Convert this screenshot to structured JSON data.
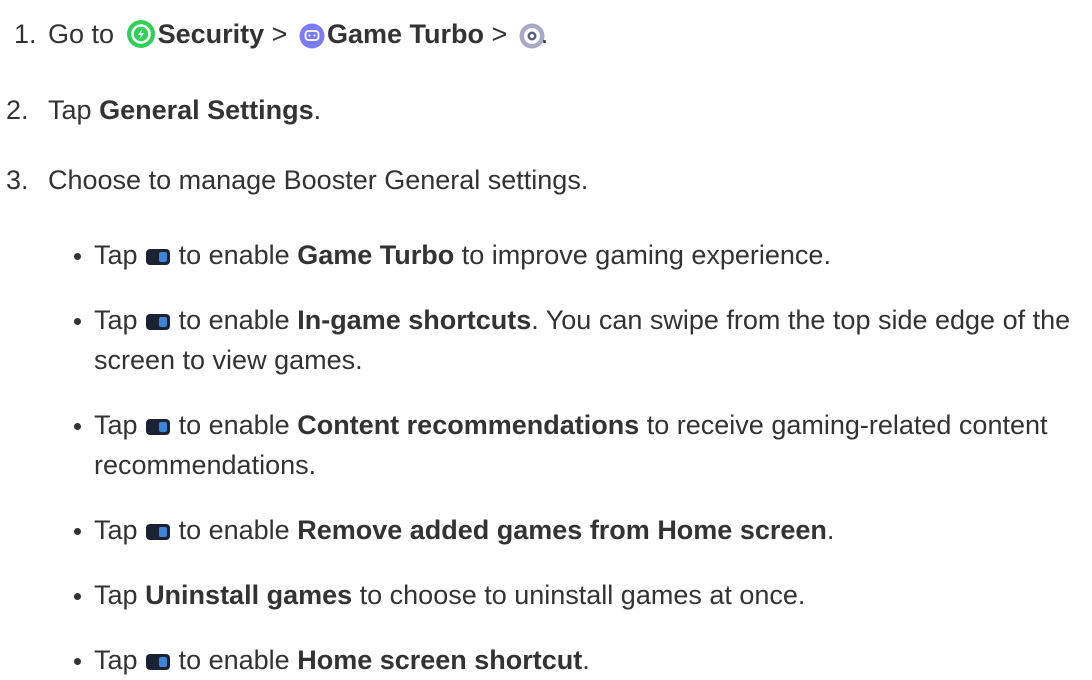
{
  "steps": [
    {
      "number": "1.",
      "prefix": "Go to",
      "security_label": "Security",
      "sep1": ">",
      "game_turbo_label": "Game Turbo",
      "sep2": ">",
      "suffix": ".",
      "icons": [
        "security-app-icon",
        "game-turbo-app-icon",
        "settings-gear-icon"
      ]
    },
    {
      "number": "2.",
      "prefix": "Tap",
      "bold": "General Settings",
      "suffix": "."
    },
    {
      "number": "3.",
      "text": "Choose to manage Booster General settings."
    }
  ],
  "bullets": [
    {
      "prefix": "Tap",
      "middle": "to enable",
      "bold": "Game Turbo",
      "suffix": "to improve gaming experience.",
      "icon": "toggle-icon"
    },
    {
      "prefix": "Tap",
      "middle": "to enable",
      "bold": "In-game shortcuts",
      "suffix": ". You can swipe from the top side edge of the screen to view games.",
      "icon": "toggle-icon"
    },
    {
      "prefix": "Tap",
      "middle": "to enable",
      "bold": "Content recommendations",
      "suffix": "to receive gaming-related content recommendations.",
      "icon": "toggle-icon"
    },
    {
      "prefix": "Tap",
      "middle": "to enable",
      "bold": "Remove added games from Home screen",
      "suffix": ".",
      "icon": "toggle-icon"
    },
    {
      "prefix": "Tap",
      "bold": "Uninstall games",
      "suffix": "to choose to uninstall games at once."
    },
    {
      "prefix": "Tap",
      "middle": "to enable",
      "bold": "Home screen shortcut",
      "suffix": ".",
      "icon": "toggle-icon"
    }
  ],
  "colors": {
    "text": "#333333",
    "security_icon": "#2fd158",
    "game_turbo_icon": "#7b7cf5",
    "settings_icon": "#a7a9c6",
    "toggle_body": "#1c2133",
    "toggle_knob": "#3e85d8"
  }
}
